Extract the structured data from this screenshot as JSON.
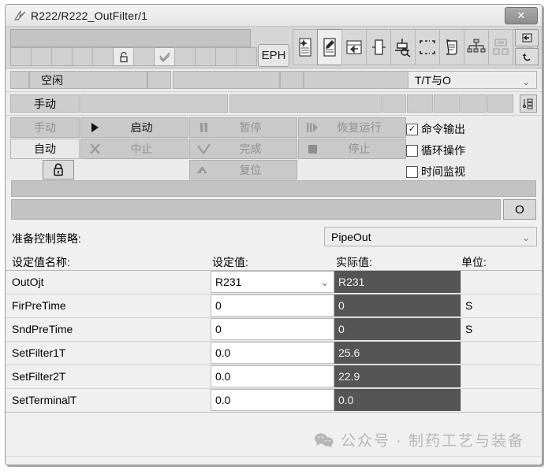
{
  "window": {
    "title": "R222/R222_OutFilter/1",
    "title_icon": "app-logo-icon",
    "close_label": "✕"
  },
  "toolbar": {
    "eph_label": "EPH",
    "slot_count": 11,
    "slots": [
      {
        "icon": "blank"
      },
      {
        "icon": "blank"
      },
      {
        "icon": "blank"
      },
      {
        "icon": "blank"
      },
      {
        "icon": "blank"
      },
      {
        "icon": "lock-open-icon"
      },
      {
        "icon": "blank"
      },
      {
        "icon": "check-stack-icon"
      },
      {
        "icon": "blank"
      },
      {
        "icon": "blank"
      },
      {
        "icon": "blank"
      },
      {
        "icon": "blank"
      }
    ],
    "icons": [
      {
        "name": "recipe-sparkle-icon",
        "selected": false
      },
      {
        "name": "edit-document-icon",
        "selected": true
      },
      {
        "name": "table-import-icon",
        "selected": false
      },
      {
        "name": "block-icon",
        "selected": false
      },
      {
        "name": "search-unit-icon",
        "selected": false
      },
      {
        "name": "select-area-icon",
        "selected": false
      },
      {
        "name": "report-scroll-icon",
        "selected": false
      },
      {
        "name": "hierarchy-icon",
        "selected": false
      },
      {
        "name": "group-blocks-icon",
        "selected": false
      },
      {
        "name": "grid-blocks-icon",
        "selected": false
      }
    ],
    "right_buttons": [
      {
        "name": "pin-icon"
      },
      {
        "name": "undo-icon"
      }
    ]
  },
  "status": {
    "state_label": "空闲",
    "mode_label": "手动",
    "top_dropdown": "T/T与O",
    "dropdown_chevron": "⌄",
    "list_icon": "list-settings-icon"
  },
  "commands": {
    "manual_label": "手动",
    "auto_label": "自动",
    "lock_icon": "lock-icon",
    "buttons": [
      {
        "label": "启动",
        "icon": "play-icon",
        "enabled": true
      },
      {
        "label": "暂停",
        "icon": "pause-icon",
        "enabled": false
      },
      {
        "label": "恢复运行",
        "icon": "resume-icon",
        "enabled": false
      },
      {
        "label": "中止",
        "icon": "abort-x-icon",
        "enabled": false
      },
      {
        "label": "完成",
        "icon": "complete-check-icon",
        "enabled": false
      },
      {
        "label": "停止",
        "icon": "stop-square-icon",
        "enabled": false
      },
      {
        "label": "复位",
        "icon": "reset-arrow-icon",
        "enabled": false
      }
    ],
    "checkboxes": [
      {
        "label": "命令输出",
        "checked": true,
        "mark": "✓"
      },
      {
        "label": "循环操作",
        "checked": false,
        "mark": ""
      },
      {
        "label": "时间监视",
        "checked": false,
        "mark": ""
      }
    ]
  },
  "infobar": {
    "o_button_label": "O"
  },
  "strategy": {
    "label": "准备控制策略:",
    "value": "PipeOut",
    "chevron": "⌄"
  },
  "table": {
    "headers": {
      "name": "设定值名称:",
      "setpoint": "设定值:",
      "actual": "实际值:",
      "unit": "单位:"
    },
    "chevron": "⌄",
    "rows": [
      {
        "name": "OutOjt",
        "setpoint": "R231",
        "actual": "R231",
        "unit": "",
        "dropdown": true
      },
      {
        "name": "FirPreTime",
        "setpoint": "0",
        "actual": "0",
        "unit": "S",
        "dropdown": false
      },
      {
        "name": "SndPreTime",
        "setpoint": "0",
        "actual": "0",
        "unit": "S",
        "dropdown": false
      },
      {
        "name": "SetFilter1T",
        "setpoint": "0.0",
        "actual": "25.6",
        "unit": "",
        "dropdown": false
      },
      {
        "name": "SetFilter2T",
        "setpoint": "0.0",
        "actual": "22.9",
        "unit": "",
        "dropdown": false
      },
      {
        "name": "SetTerminalT",
        "setpoint": "0.0",
        "actual": "0.0",
        "unit": "",
        "dropdown": false
      }
    ]
  },
  "watermark": {
    "icon": "wechat-icon",
    "text": "公众号 · 制药工艺与装备"
  },
  "colors": {
    "window_bg": "#f0f0f0",
    "toolbar_bg": "#d6d6d6",
    "actual_cell_bg": "#555555",
    "actual_cell_text": "#f2f2f2",
    "disabled_text": "#919191",
    "watermark": "#b6b6b6"
  }
}
